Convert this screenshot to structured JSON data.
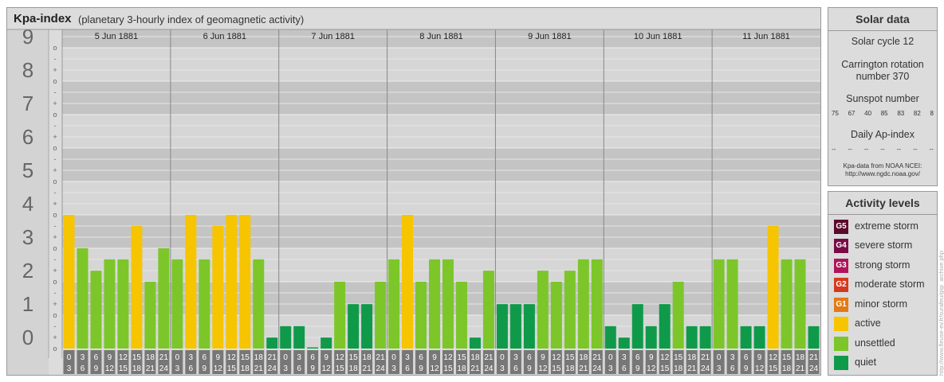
{
  "header": {
    "title": "Kpa-index",
    "subtitle": "(planetary 3-hourly index of geomagnetic activity)"
  },
  "chart_data": {
    "type": "bar",
    "y_levels": [
      "0",
      "1",
      "2",
      "3",
      "4",
      "5",
      "6",
      "7",
      "8",
      "9"
    ],
    "sublevels": [
      "o",
      "+",
      "-"
    ],
    "days": [
      {
        "date": "5 Jun 1881",
        "values": [
          4.0,
          3.0,
          2.33,
          2.67,
          2.67,
          3.67,
          2.0,
          3.0
        ]
      },
      {
        "date": "6 Jun 1881",
        "values": [
          2.67,
          4.0,
          2.67,
          3.67,
          4.0,
          4.0,
          2.67,
          0.33
        ]
      },
      {
        "date": "7 Jun 1881",
        "values": [
          0.67,
          0.67,
          0.0,
          0.33,
          2.0,
          1.33,
          1.33,
          2.0
        ]
      },
      {
        "date": "8 Jun 1881",
        "values": [
          2.67,
          4.0,
          2.0,
          2.67,
          2.67,
          2.0,
          0.33,
          2.33
        ]
      },
      {
        "date": "9 Jun 1881",
        "values": [
          1.33,
          1.33,
          1.33,
          2.33,
          2.0,
          2.33,
          2.67,
          2.67
        ]
      },
      {
        "date": "10 Jun 1881",
        "values": [
          0.67,
          0.33,
          1.33,
          0.67,
          1.33,
          2.0,
          0.67,
          0.67
        ]
      },
      {
        "date": "11 Jun 1881",
        "values": [
          2.67,
          2.67,
          0.67,
          0.67,
          3.67,
          2.67,
          2.67,
          0.67
        ]
      }
    ],
    "interval_labels": [
      [
        "0",
        "3"
      ],
      [
        "3",
        "6"
      ],
      [
        "6",
        "9"
      ],
      [
        "9",
        "12"
      ],
      [
        "12",
        "15"
      ],
      [
        "15",
        "18"
      ],
      [
        "18",
        "21"
      ],
      [
        "21",
        "24"
      ]
    ],
    "ylim": [
      0,
      9
    ],
    "colors": {
      "quiet": "#0f9a4a",
      "unsettled": "#7cc62a",
      "active": "#f6c500"
    }
  },
  "solar": {
    "title": "Solar data",
    "cycle": "Solar cycle 12",
    "carrington_line1": "Carrington rotation",
    "carrington_line2": "number 370",
    "sunspot_label": "Sunspot number",
    "sunspot_values": [
      "75",
      "67",
      "40",
      "85",
      "83",
      "82",
      "8"
    ],
    "ap_label": "Daily Ap-index",
    "ap_values": [
      "--",
      "--",
      "--",
      "--",
      "--",
      "--",
      "--"
    ],
    "source_line1": "Kpa-data from NOAA NCEI:",
    "source_line2": "http://www.ngdc.noaa.gov/"
  },
  "levels": {
    "title": "Activity levels",
    "items": [
      {
        "badge": "G5",
        "label": "extreme storm",
        "color": "#5a0a2a"
      },
      {
        "badge": "G4",
        "label": "severe storm",
        "color": "#7a0a45"
      },
      {
        "badge": "G3",
        "label": "strong storm",
        "color": "#b0145a"
      },
      {
        "badge": "G2",
        "label": "moderate storm",
        "color": "#d43a1e"
      },
      {
        "badge": "G1",
        "label": "minor storm",
        "color": "#e27a16"
      },
      {
        "badge": "",
        "label": "active",
        "color": "#f6c500"
      },
      {
        "badge": "",
        "label": "unsettled",
        "color": "#7cc62a"
      },
      {
        "badge": "",
        "label": "quiet",
        "color": "#0f9a4a"
      }
    ]
  },
  "credit": "http://www.fleuse-ev.fr/surafeu/gigi_archive.php"
}
